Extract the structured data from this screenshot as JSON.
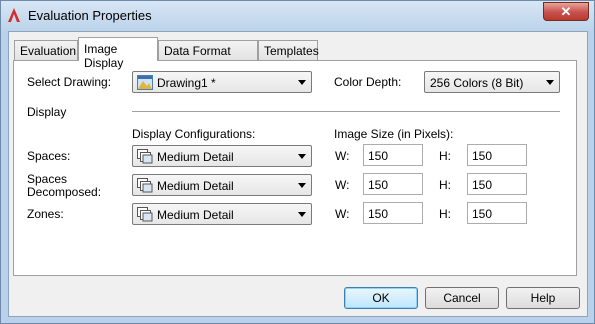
{
  "window": {
    "title": "Evaluation Properties",
    "close_glyph": "✕"
  },
  "tabs": [
    {
      "label": "Evaluation"
    },
    {
      "label": "Image Display"
    },
    {
      "label": "Data Format Styles"
    },
    {
      "label": "Templates"
    }
  ],
  "image_display": {
    "select_drawing_label": "Select Drawing:",
    "select_drawing_value": "Drawing1 *",
    "color_depth_label": "Color Depth:",
    "color_depth_value": "256 Colors (8 Bit)",
    "display_group_label": "Display",
    "display_configurations_label": "Display Configurations:",
    "image_size_label": "Image Size (in Pixels):",
    "rows": [
      {
        "label": "Spaces:",
        "config": "Medium Detail",
        "w_label": "W:",
        "w": "150",
        "h_label": "H:",
        "h": "150"
      },
      {
        "label": "Spaces\nDecomposed:",
        "label_line1": "Spaces",
        "label_line2": "Decomposed:",
        "config": "Medium Detail",
        "w_label": "W:",
        "w": "150",
        "h_label": "H:",
        "h": "150"
      },
      {
        "label": "Zones:",
        "config": "Medium Detail",
        "w_label": "W:",
        "w": "150",
        "h_label": "H:",
        "h": "150"
      }
    ]
  },
  "buttons": {
    "ok": "OK",
    "cancel": "Cancel",
    "help": "Help"
  },
  "colors": {
    "title_bar": "#bcd3ea",
    "close_button": "#c75050",
    "accent_app_icon": "#d42b2b"
  }
}
